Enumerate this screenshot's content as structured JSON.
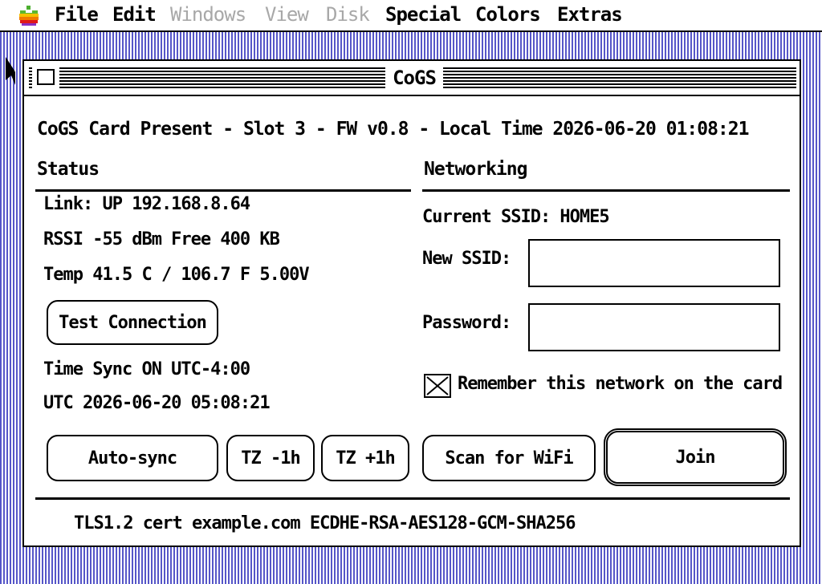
{
  "menubar": {
    "items": [
      {
        "label": "File",
        "enabled": true
      },
      {
        "label": "Edit",
        "enabled": true
      },
      {
        "label": "Windows",
        "enabled": false
      },
      {
        "label": "View",
        "enabled": false
      },
      {
        "label": "Disk",
        "enabled": false
      },
      {
        "label": "Special",
        "enabled": true
      },
      {
        "label": "Colors",
        "enabled": true
      },
      {
        "label": "Extras",
        "enabled": true
      }
    ]
  },
  "window": {
    "title": "CoGS",
    "header": "CoGS Card Present - Slot 3 - FW v0.8 - Local Time 2026-06-20 01:08:21"
  },
  "status": {
    "title": "Status",
    "link": "Link: UP  192.168.8.64",
    "rssi": "RSSI -55 dBm  Free 400 KB",
    "temp": "Temp 41.5 C / 106.7 F 5.00V",
    "test_button": "Test Connection",
    "time_line": "Time  Sync ON UTC-4:00",
    "utc_line": "UTC  2026-06-20 05:08:21",
    "autosync_button": "Auto-sync",
    "tz_minus_button": "TZ -1h",
    "tz_plus_button": "TZ +1h"
  },
  "networking": {
    "title": "Networking",
    "current_ssid": "Current SSID: HOME5",
    "new_ssid_label": "New SSID:",
    "new_ssid_value": "",
    "password_label": "Password:",
    "password_value": "",
    "remember_label": "Remember this network on the card",
    "remember_checked": true,
    "scan_button": "Scan for WiFi",
    "join_button": "Join"
  },
  "footer": {
    "tls": "TLS1.2 cert example.com ECDHE-RSA-AES128-GCM-SHA256"
  },
  "colors": {
    "desktop": "#6a6ad8",
    "window_bg": "#ffffff",
    "ink": "#000000"
  }
}
